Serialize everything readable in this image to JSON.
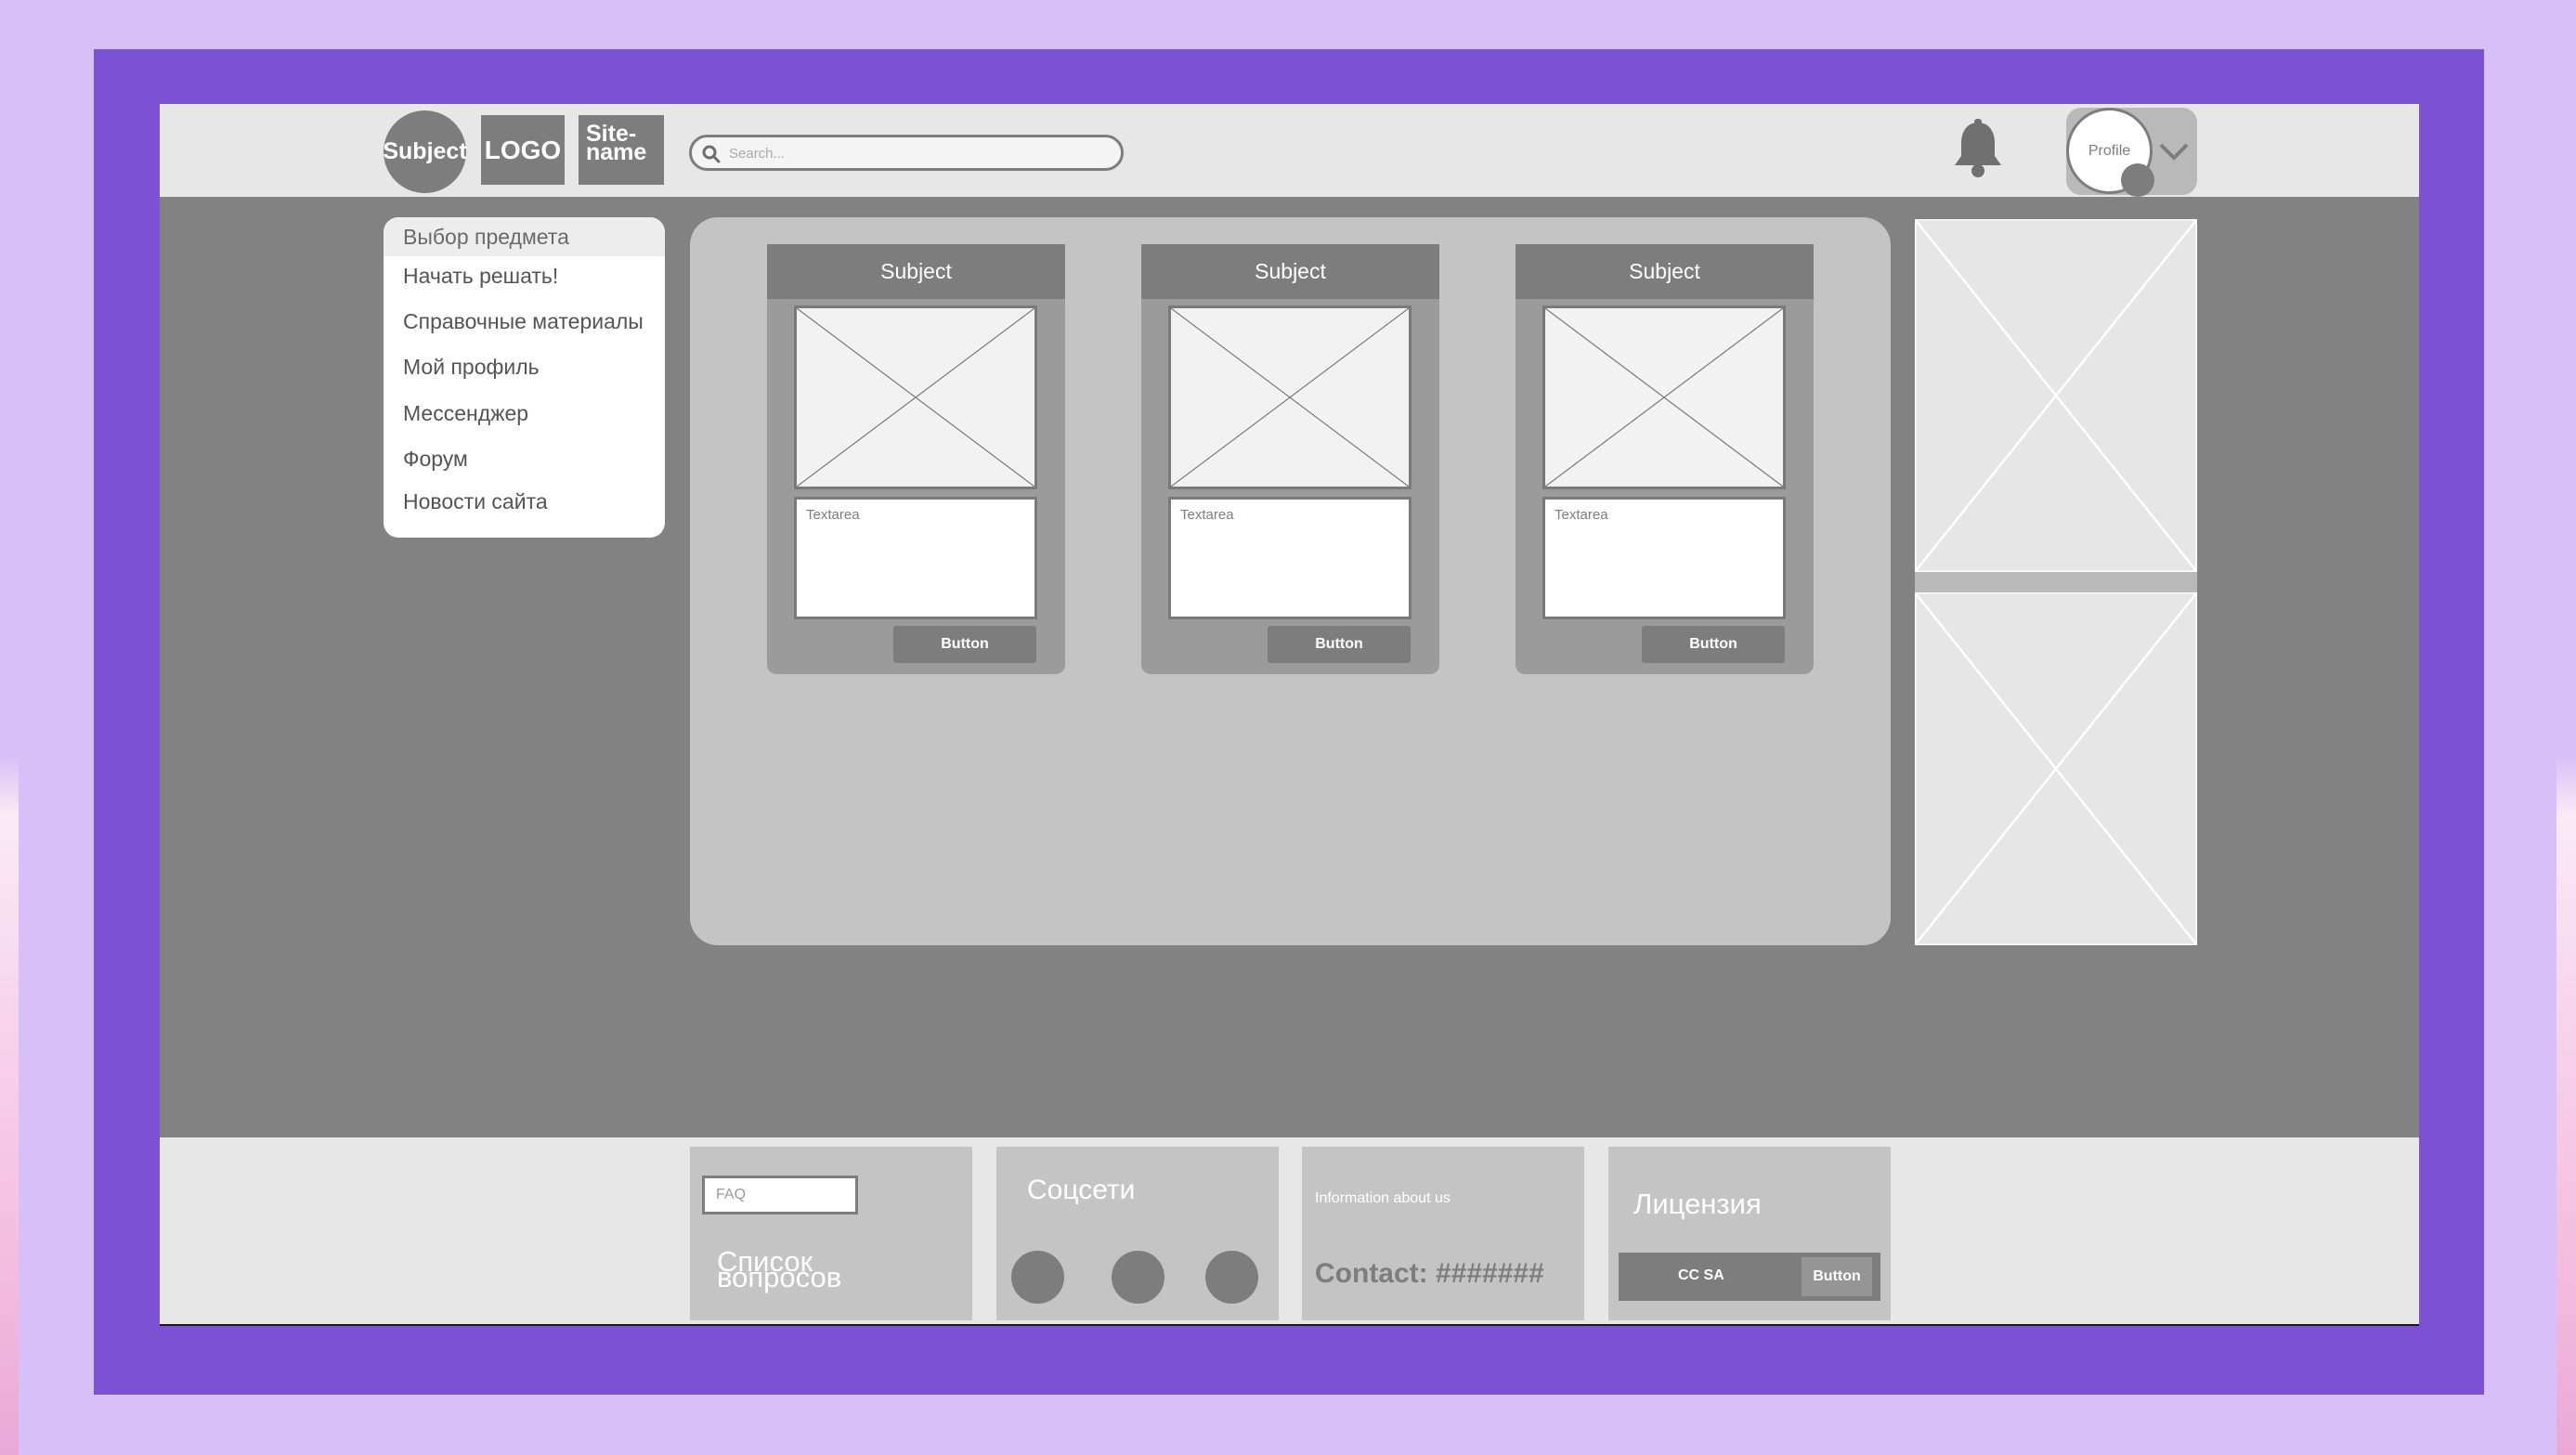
{
  "header": {
    "subject_badge": "Subject",
    "logo": "LOGO",
    "sitename_line1": "Site-",
    "sitename_line2": "name",
    "search_placeholder": "Search...",
    "profile_label": "Profile"
  },
  "menu": {
    "items": [
      {
        "label": "Выбор предмета",
        "active": true
      },
      {
        "label": "Начать решать!"
      },
      {
        "label": "Справочные материалы"
      },
      {
        "label": "Мой профиль"
      },
      {
        "label": "Мессенджер"
      },
      {
        "label": "Форум"
      },
      {
        "label": "Новости сайта"
      }
    ]
  },
  "cards": [
    {
      "title": "Subject",
      "textarea_placeholder": "Textarea",
      "button_label": "Button"
    },
    {
      "title": "Subject",
      "textarea_placeholder": "Textarea",
      "button_label": "Button"
    },
    {
      "title": "Subject",
      "textarea_placeholder": "Textarea",
      "button_label": "Button"
    }
  ],
  "footer": {
    "faq": {
      "input_placeholder": "FAQ",
      "text_line1": "Список",
      "text_line2": "вопросов"
    },
    "social": {
      "title": "Соцсети"
    },
    "about": {
      "info": "Information about us",
      "contact": "Contact: #######"
    },
    "license": {
      "title": "Лицензия",
      "text": "CC SA",
      "button_label": "Button"
    }
  },
  "colors": {
    "frame_outer": "#d9bff8",
    "frame_inner": "#7c51d3",
    "screen_bg": "#828282",
    "header_bg": "#e7e7e7",
    "panel_bg": "#c4c4c4",
    "block_dark": "#7d7d7d"
  }
}
